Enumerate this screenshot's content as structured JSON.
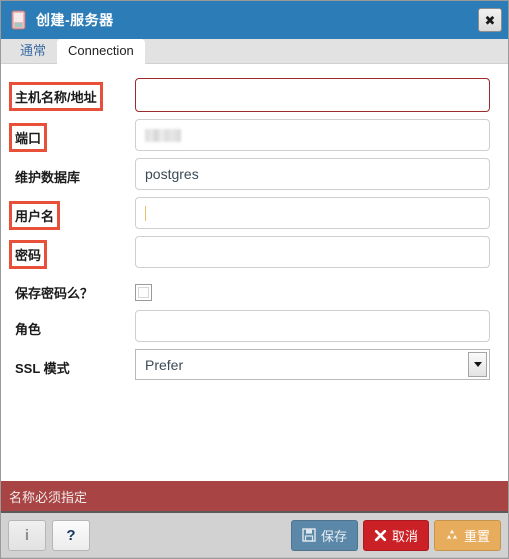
{
  "window": {
    "title": "创建-服务器",
    "icon": "server-icon",
    "close_label": "✖",
    "accent_titlebar": "#2c7cb8"
  },
  "tabs": [
    {
      "label": "通常",
      "active": false
    },
    {
      "label": "Connection",
      "active": true
    }
  ],
  "form": {
    "rows": [
      {
        "name": "host-address",
        "label": "主机名称/地址",
        "marked": true,
        "type": "text",
        "value": "",
        "state": "error"
      },
      {
        "name": "port",
        "label": "端口",
        "marked": true,
        "type": "redacted",
        "value": "",
        "state": "normal"
      },
      {
        "name": "maintenance-database",
        "label": "维护数据库",
        "marked": false,
        "type": "text",
        "value": "postgres",
        "state": "normal"
      },
      {
        "name": "username",
        "label": "用户名",
        "marked": true,
        "type": "text",
        "value": "",
        "state": "focus"
      },
      {
        "name": "password",
        "label": "密码",
        "marked": true,
        "type": "password",
        "value": "",
        "state": "normal"
      },
      {
        "name": "save-password",
        "label": "保存密码么？",
        "marked": false,
        "type": "checkbox",
        "value": "",
        "checked": false
      },
      {
        "name": "role",
        "label": "角色",
        "marked": false,
        "type": "text",
        "value": "",
        "state": "normal"
      },
      {
        "name": "ssl-mode",
        "label": "SSL 模式",
        "marked": false,
        "type": "select",
        "value": "Prefer",
        "state": "normal"
      }
    ]
  },
  "status": {
    "message": "名称必须指定",
    "background": "#a84444"
  },
  "footer": {
    "info_label": "i",
    "help_label": "?",
    "actions": [
      {
        "name": "save-button",
        "label": "保存",
        "icon": "floppy-disk-icon",
        "color": "#5b87a8",
        "disabled": true
      },
      {
        "name": "cancel-button",
        "label": "取消",
        "icon": "cross-icon",
        "color": "#ca2026",
        "disabled": false
      },
      {
        "name": "reset-button",
        "label": "重置",
        "icon": "recycle-icon",
        "color": "#e8ad5c",
        "disabled": false
      }
    ]
  },
  "annotation": {
    "highlight_color": "#e8503a"
  }
}
